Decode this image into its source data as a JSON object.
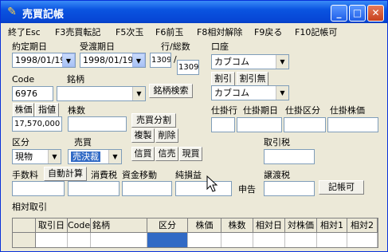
{
  "window": {
    "title": "売買記帳"
  },
  "menu": [
    "終了Esc",
    "F3売買転記",
    "F5次玉",
    "F6前玉",
    "F8相対解除",
    "F9戻る",
    "F10記帳可"
  ],
  "fields": {
    "contract_date_label": "約定期日",
    "contract_date": "1998/01/19",
    "delivery_date_label": "受渡期日",
    "delivery_date": "1998/01/19",
    "row_total_label": "行/総数",
    "row_value": "1309",
    "total_value": "1309",
    "account_label": "口座",
    "account_value": "カブコム",
    "code_label": "Code",
    "code_value": "6976",
    "stock_name_label": "銘柄",
    "stock_name_value": "",
    "stock_search_button": "銘柄検索",
    "margin_label": "割引",
    "margin_none_label": "割引無",
    "margin_account_value": "カブコム",
    "price_label": "株価",
    "limit_label": "指値",
    "shares_label": "株数",
    "price_value": "17,570,000",
    "shares_value": "",
    "split_button": "売買分割",
    "copy_button": "複製",
    "delete_button": "削除",
    "pending_row_label": "仕掛行",
    "pending_date_label": "仕掛期日",
    "pending_type_label": "仕掛区分",
    "pending_price_label": "仕掛株価",
    "category_label": "区分",
    "category_value": "現物",
    "buy_sell_label": "売買",
    "buy_sell_value": "売決裁",
    "margin_buy_button": "信買",
    "margin_sell_button": "信売",
    "spot_buy_button": "現買",
    "tax_label": "取引税",
    "fee_label": "手数料",
    "auto_calc_button": "自動計算",
    "consumption_tax_label": "消費税",
    "fund_transfer_label": "資金移動",
    "net_pl_label": "純損益",
    "report_label": "申告",
    "transfer_tax_label": "譲渡税",
    "record_button": "記帳可",
    "relative_trade_label": "相対取引"
  },
  "grid": {
    "headers": [
      "",
      "取引日",
      "Code",
      "銘柄",
      "区分",
      "株価",
      "株数",
      "相対日",
      "対株価",
      "相対1",
      "相対2"
    ]
  }
}
